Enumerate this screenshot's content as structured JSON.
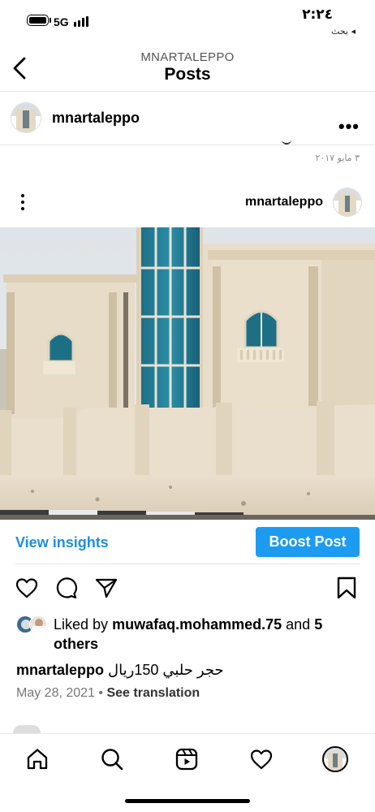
{
  "status_bar": {
    "time": "٢:٢٤",
    "back_app": "بحث ◂",
    "network": "5G"
  },
  "header": {
    "username": "MNARTALEPPO",
    "title": "Posts"
  },
  "prev_post": {
    "username": "mnartaleppo",
    "more": "•••",
    "date": "٣ مايو ٢٠١٧"
  },
  "post": {
    "username": "mnartaleppo",
    "view_insights": "View insights",
    "boost_post": "Boost Post",
    "liked_by_prefix": "Liked by",
    "liked_by_user": "muwafaq.mohammed.75",
    "liked_by_and": "and",
    "liked_by_others": "5 others",
    "caption_user": "mnartaleppo",
    "caption_text": "حجر حلبي 150ريال",
    "date": "May 28, 2021",
    "separator": "•",
    "see_translation": "See translation"
  },
  "icons": {
    "like": "heart-outline",
    "comment": "speech-bubble",
    "share": "paper-plane",
    "save": "bookmark",
    "home": "home",
    "search": "magnifier",
    "reels": "reels",
    "activity": "heart-outline",
    "profile": "avatar"
  },
  "colors": {
    "accent": "#1d9bf0",
    "link": "#1d8fe0"
  }
}
